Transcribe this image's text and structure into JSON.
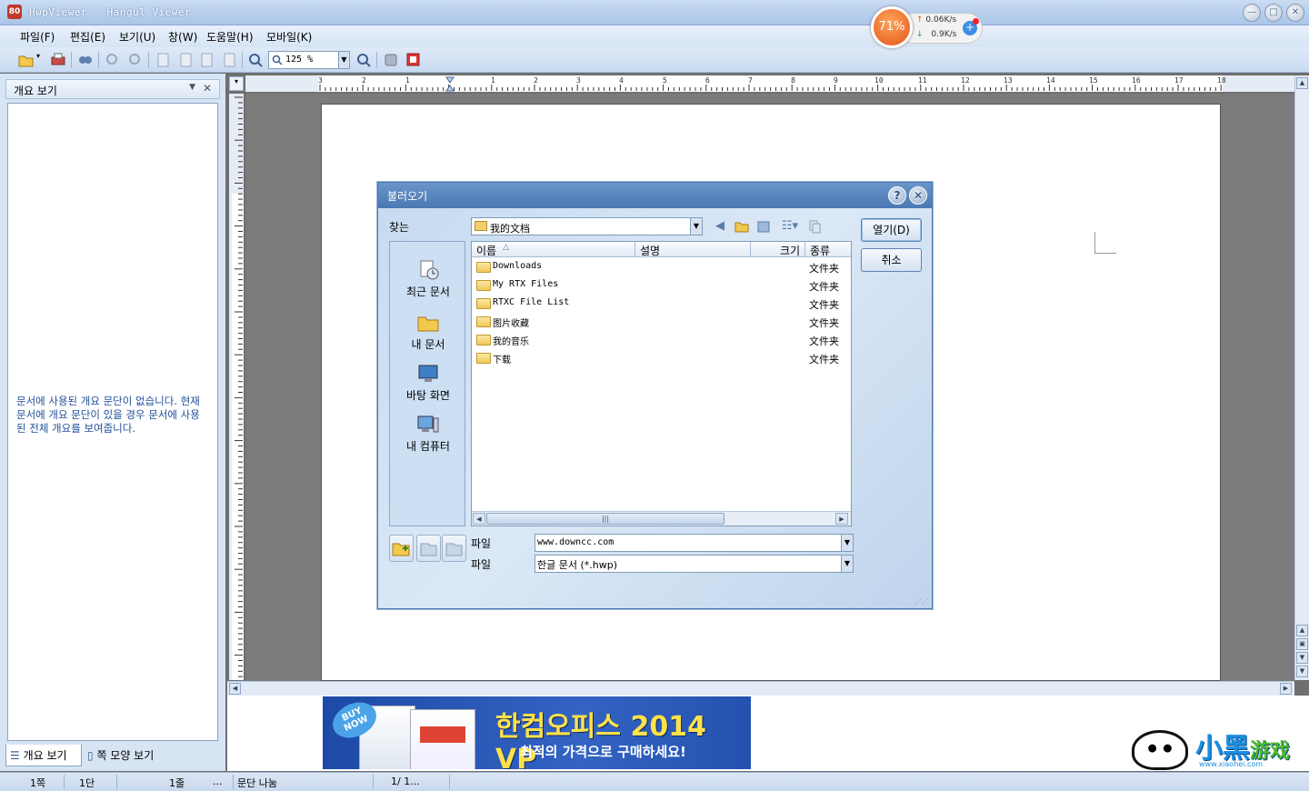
{
  "window": {
    "title": "HwpViewer - Hangul Viewer",
    "app_icon_text": "80",
    "buttons": {
      "minimize": "—",
      "maximize": "□",
      "close": "✕"
    }
  },
  "menu": [
    {
      "label": "파일(F)"
    },
    {
      "label": "편집(E)"
    },
    {
      "label": "보기(U)"
    },
    {
      "label": "창(W)"
    },
    {
      "label": "도움말(H)"
    },
    {
      "label": "모바일(K)"
    }
  ],
  "toolbar": {
    "zoom_value": "125 %",
    "icons": [
      "open-folder-icon",
      "print-icon",
      "find-icon",
      "find-replace-icon",
      "find-next-icon",
      "first-page-icon",
      "previous-page-icon",
      "next-page-icon",
      "last-page-icon",
      "zoom-fit-icon",
      "zoom-in-icon",
      "info-icon",
      "hancom-icon"
    ]
  },
  "netspeed": {
    "percent": "71%",
    "upload": "0.06K/s",
    "download": "0.9K/s",
    "up_arrow": "↑",
    "down_arrow": "↓",
    "plus": "+"
  },
  "left_panel": {
    "title": "개요 보기",
    "dropdown_icon": "▼",
    "close_icon": "✕",
    "message": "문서에 사용된 개요 문단이 없습니다. 현재 문서에 개요 문단이 있을 경우 문서에 사용된 전체 개요를 보여줍니다.",
    "tabs": [
      {
        "label": "개요 보기"
      },
      {
        "label": "쪽 모양 보기"
      }
    ]
  },
  "ruler": {
    "h_numbers": [
      "3",
      "2",
      "1",
      "1",
      "1",
      "2",
      "3",
      "4",
      "5",
      "6",
      "7",
      "8",
      "9",
      "10",
      "11",
      "12",
      "13",
      "14",
      "15",
      "16",
      "17",
      "18"
    ],
    "v_numbers": [
      "3",
      "2",
      "1",
      "1",
      "0",
      "1",
      "2",
      "3",
      "4",
      "5",
      "6",
      "7",
      "8",
      "9",
      "10"
    ]
  },
  "dialog": {
    "title": "불러오기",
    "help_label": "?",
    "close_label": "✕",
    "lookin_label": "찾는",
    "lookin_value": "我的文档",
    "places": [
      {
        "label": "최근 문서",
        "icon": "recent-documents-icon"
      },
      {
        "label": "내 문서",
        "icon": "my-documents-icon"
      },
      {
        "label": "바탕 화면",
        "icon": "desktop-icon"
      },
      {
        "label": "내 컴퓨터",
        "icon": "my-computer-icon"
      }
    ],
    "columns": [
      "이름",
      "설명",
      "크기",
      "종류"
    ],
    "sort_indicator": "△",
    "files": [
      {
        "name": "Downloads",
        "type": "文件夹"
      },
      {
        "name": "My RTX Files",
        "type": "文件夹"
      },
      {
        "name": "RTXC File List",
        "type": "文件夹"
      },
      {
        "name": "图片收藏",
        "type": "文件夹"
      },
      {
        "name": "我的音乐",
        "type": "文件夹"
      },
      {
        "name": "下载",
        "type": "文件夹"
      }
    ],
    "open_button": "열기(D)",
    "cancel_button": "취소",
    "filename_label": "파일",
    "filename_value": "www.downcc.com",
    "filetype_label": "파일",
    "filetype_value": "한글 문서 (*.hwp)"
  },
  "banner": {
    "buy_now": "BUY NOW",
    "title": "한컴오피스 2014 VP",
    "subtitle": "최적의 가격으로 구매하세요!"
  },
  "watermark": {
    "text_main": "小黑",
    "text_game": "游戏",
    "url": "www.xiaohei.com"
  },
  "status": {
    "page": "1쪽",
    "column": "1단",
    "line": "1줄",
    "dots": "...",
    "paragraph": "문단 나눔",
    "pages": "1/  1..."
  }
}
